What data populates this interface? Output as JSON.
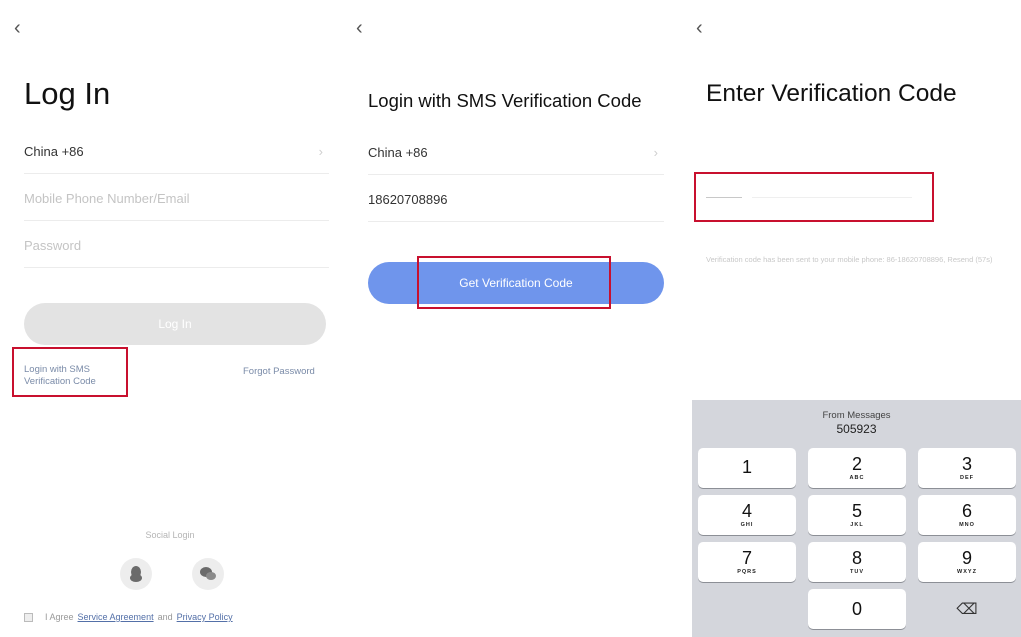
{
  "panel1": {
    "back": "‹",
    "title": "Log In",
    "country": "China +86",
    "phone_placeholder": "Mobile Phone Number/Email",
    "password_placeholder": "Password",
    "login_button": "Log In",
    "sms_link_line1": "Login with SMS",
    "sms_link_line2": "Verification Code",
    "forgot": "Forgot Password",
    "social_title": "Social Login",
    "agree_prefix": "I Agree",
    "service": "Service Agreement",
    "and": "and",
    "privacy": "Privacy Policy"
  },
  "panel2": {
    "back": "‹",
    "title": "Login with SMS Verification Code",
    "country": "China +86",
    "phone_value": "18620708896",
    "button": "Get Verification Code"
  },
  "panel3": {
    "back": "‹",
    "title": "Enter Verification Code",
    "hint": "Verification code has been sent to your mobile phone: 86-18620708896, Resend (57s)",
    "keyboard": {
      "from": "From Messages",
      "code": "505923",
      "keys": [
        {
          "n": "1",
          "l": ""
        },
        {
          "n": "2",
          "l": "ABC"
        },
        {
          "n": "3",
          "l": "DEF"
        },
        {
          "n": "4",
          "l": "GHI"
        },
        {
          "n": "5",
          "l": "JKL"
        },
        {
          "n": "6",
          "l": "MNO"
        },
        {
          "n": "7",
          "l": "PQRS"
        },
        {
          "n": "8",
          "l": "TUV"
        },
        {
          "n": "9",
          "l": "WXYZ"
        },
        {
          "n": "0",
          "l": ""
        }
      ],
      "delete": "⌫"
    }
  },
  "colors": {
    "highlight": "#c8102e",
    "primary_button": "#6f95ec",
    "disabled_button": "#e3e3e3"
  }
}
